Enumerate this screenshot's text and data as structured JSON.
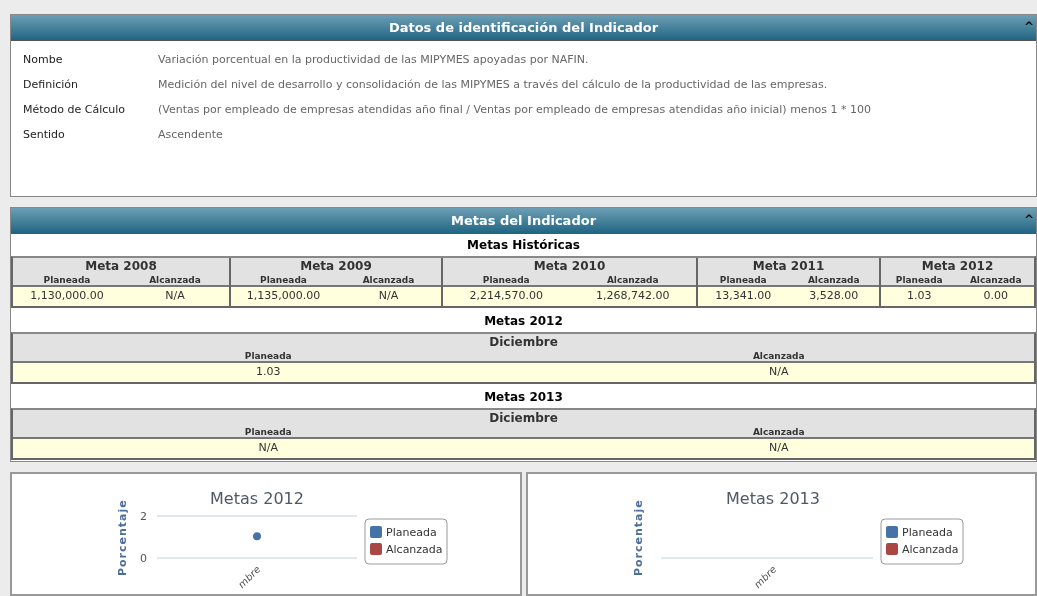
{
  "identification": {
    "title": "Datos de identificación del Indicador",
    "collapse": "^",
    "fields": [
      {
        "label": "Nombe",
        "value": "Variación porcentual en la productividad de las MIPYMES apoyadas por NAFIN."
      },
      {
        "label": "Definición",
        "value": "Medición del nivel de desarrollo y consolidación de las MIPYMES a través del cálculo de la productividad de las empresas."
      },
      {
        "label": "Método de Cálculo",
        "value": "(Ventas por empleado de empresas atendidas año final / Ventas por empleado de empresas atendidas año inicial) menos 1 * 100"
      },
      {
        "label": "Sentido",
        "value": "Ascendente"
      }
    ]
  },
  "goals": {
    "title": "Metas del Indicador",
    "collapse": "^",
    "historic": {
      "title": "Metas Históricas",
      "years": [
        {
          "name": "Meta 2008",
          "planned_label": "Planeada",
          "achieved_label": "Alcanzada",
          "planned": "1,130,000.00",
          "achieved": "N/A"
        },
        {
          "name": "Meta 2009",
          "planned_label": "Planeada",
          "achieved_label": "Alcanzada",
          "planned": "1,135,000.00",
          "achieved": "N/A"
        },
        {
          "name": "Meta 2010",
          "planned_label": "Planeada",
          "achieved_label": "Alcanzada",
          "planned": "2,214,570.00",
          "achieved": "1,268,742.00"
        },
        {
          "name": "Meta 2011",
          "planned_label": "Planeada",
          "achieved_label": "Alcanzada",
          "planned": "13,341.00",
          "achieved": "3,528.00"
        },
        {
          "name": "Meta 2012",
          "planned_label": "Planeada",
          "achieved_label": "Alcanzada",
          "planned": "1.03",
          "achieved": "0.00"
        }
      ]
    },
    "yearly": [
      {
        "title": "Metas 2012",
        "month": "Diciembre",
        "planned_label": "Planeada",
        "achieved_label": "Alcanzada",
        "planned": "1.03",
        "achieved": "N/A"
      },
      {
        "title": "Metas 2013",
        "month": "Diciembre",
        "planned_label": "Planeada",
        "achieved_label": "Alcanzada",
        "planned": "N/A",
        "achieved": "N/A"
      }
    ]
  },
  "charts": [
    {
      "chart_data": {
        "type": "scatter",
        "title": "Metas 2012",
        "ylabel": "Porcentaje",
        "categories": [
          "mbre"
        ],
        "ylim": [
          0,
          2
        ],
        "yticks": [
          0,
          2
        ],
        "series": [
          {
            "name": "Planeada",
            "color": "#4572a7",
            "values": [
              1.03
            ]
          },
          {
            "name": "Alcanzada",
            "color": "#aa4643",
            "values": [
              null
            ]
          }
        ]
      }
    },
    {
      "title": "Metas 2013",
      "ylabel": "Porcentaje",
      "category": "mbre",
      "legend": [
        {
          "name": "Planeada",
          "color": "#4572a7"
        },
        {
          "name": "Alcanzada",
          "color": "#aa4643"
        }
      ]
    }
  ]
}
